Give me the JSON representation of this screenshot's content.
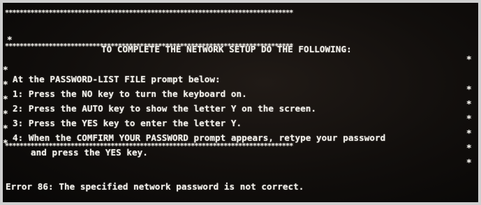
{
  "screen": {
    "border_top": "*******************************************************************************",
    "title_row": {
      "left_marker": "*",
      "title": "TO COMPLETE THE NETWORK SETUP DO THE FOLLOWING:",
      "right_marker": "*"
    },
    "border_mid": "*******************************************************************************",
    "instructions": [
      {
        "marker": "*",
        "text": "At the PASSWORD-LIST FILE prompt below:",
        "right_marker": "*"
      },
      {
        "marker": "*",
        "text": "1: Press the NO key to turn the keyboard on.",
        "right_marker": "*"
      },
      {
        "marker": "*",
        "text": "2: Press the AUTO key to show the letter Y on the screen.",
        "right_marker": "*"
      },
      {
        "marker": "*",
        "text": "3: Press the YES key to enter the letter Y.",
        "right_marker": "*"
      },
      {
        "marker": "*",
        "text": "4: When the COMFIRM YOUR PASSWORD prompt appears, retype your password",
        "right_marker": "*"
      },
      {
        "marker": "*",
        "text": "and press the YES key.",
        "right_marker": "*"
      }
    ],
    "border_bottom": "*******************************************************************************",
    "error_message": "Error 86: The specified network password is not correct."
  }
}
